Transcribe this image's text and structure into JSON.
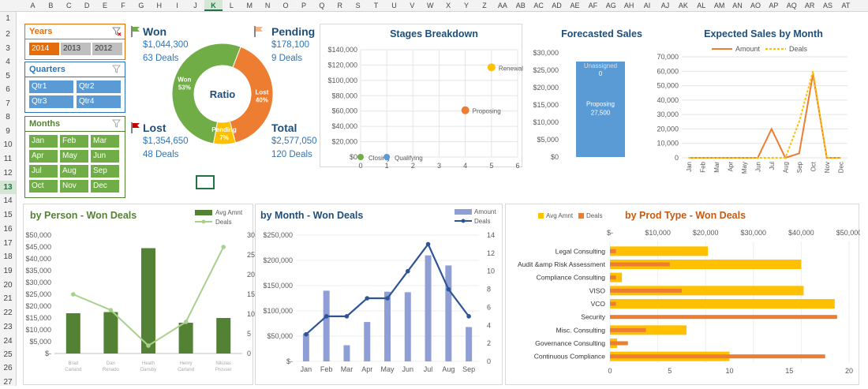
{
  "sheet": {
    "columns": [
      "A",
      "B",
      "C",
      "D",
      "E",
      "F",
      "G",
      "H",
      "I",
      "J",
      "K",
      "L",
      "M",
      "N",
      "O",
      "P",
      "Q",
      "R",
      "S",
      "T",
      "U",
      "V",
      "W",
      "X",
      "Y",
      "Z",
      "AA",
      "AB",
      "AC",
      "AD",
      "AE",
      "AF",
      "AG",
      "AH",
      "AI",
      "AJ",
      "AK",
      "AL",
      "AM",
      "AN",
      "AO",
      "AP",
      "AQ",
      "AR",
      "AS",
      "AT"
    ],
    "selected_column": "K",
    "rows": [
      "1",
      "2",
      "3",
      "4",
      "5",
      "6",
      "7",
      "8",
      "9",
      "10",
      "11",
      "12",
      "13",
      "14",
      "15",
      "16",
      "17",
      "18",
      "19",
      "20",
      "21",
      "22",
      "23",
      "24",
      "25",
      "26",
      "27"
    ],
    "selected_row": "13"
  },
  "slicers": {
    "years": {
      "title": "Years",
      "items": [
        "2014",
        "2013",
        "2012"
      ],
      "selected": "2014"
    },
    "quarters": {
      "title": "Quarters",
      "items": [
        "Qtr1",
        "Qtr2",
        "Qtr3",
        "Qtr4"
      ]
    },
    "months": {
      "title": "Months",
      "items": [
        "Jan",
        "Feb",
        "Mar",
        "Apr",
        "May",
        "Jun",
        "Jul",
        "Aug",
        "Sep",
        "Oct",
        "Nov",
        "Dec"
      ]
    }
  },
  "kpis": {
    "won": {
      "title": "Won",
      "amount": "$1,044,300",
      "deals": "63 Deals"
    },
    "pending": {
      "title": "Pending",
      "amount": "$178,100",
      "deals": "9 Deals"
    },
    "lost": {
      "title": "Lost",
      "amount": "$1,354,650",
      "deals": "48 Deals"
    },
    "total": {
      "title": "Total",
      "amount": "$2,577,050",
      "deals": "120 Deals"
    }
  },
  "colors": {
    "won": "#70ad47",
    "lost": "#ed7d31",
    "pending": "#ffc000",
    "blue": "#5b9bd5",
    "darkgreen": "#548235",
    "title_blue": "#1f4e79",
    "periwinkle": "#8f9fd6",
    "navy": "#2f5597"
  },
  "chart_data": [
    {
      "id": "ratio",
      "type": "pie",
      "title": "Ratio",
      "labels": [
        "Won",
        "Lost",
        "Pending"
      ],
      "values": [
        53,
        40,
        7
      ],
      "value_labels": [
        "53%",
        "40%",
        "7%"
      ]
    },
    {
      "id": "stages",
      "type": "scatter",
      "title": "Stages Breakdown",
      "xlim": [
        0,
        6
      ],
      "ylim": [
        0,
        140000
      ],
      "x_ticks": [
        "0",
        "1",
        "2",
        "3",
        "4",
        "5",
        "6"
      ],
      "y_ticks": [
        "$0",
        "$20,000",
        "$40,000",
        "$60,000",
        "$80,000",
        "$100,000",
        "$120,000",
        "$140,000"
      ],
      "points": [
        {
          "name": "Closing",
          "x": 0,
          "y": 0
        },
        {
          "name": "Qualifying",
          "x": 1,
          "y": 0
        },
        {
          "name": "Proposing",
          "x": 4,
          "y": 61000
        },
        {
          "name": "Renewal",
          "x": 5,
          "y": 117000
        }
      ]
    },
    {
      "id": "forecast",
      "type": "bar",
      "title": "Forecasted Sales",
      "ylim": [
        0,
        30000
      ],
      "y_ticks": [
        "$0",
        "$5,000",
        "$10,000",
        "$15,000",
        "$20,000",
        "$25,000",
        "$30,000"
      ],
      "stack": [
        {
          "name": "Proposing",
          "value": 27500,
          "label": "27,500"
        },
        {
          "name": "Unassigned",
          "value": 0,
          "label": "0"
        }
      ]
    },
    {
      "id": "expected",
      "type": "line",
      "title": "Expected Sales by Month",
      "categories": [
        "Jan",
        "Feb",
        "Mar",
        "Apr",
        "May",
        "Jun",
        "Jul",
        "Aug",
        "Sep",
        "Oct",
        "Nov",
        "Dec"
      ],
      "ylim": [
        0,
        70000
      ],
      "y_ticks": [
        "0",
        "10,000",
        "20,000",
        "30,000",
        "40,000",
        "50,000",
        "60,000",
        "70,000"
      ],
      "series": [
        {
          "name": "Amount",
          "values": [
            0,
            0,
            0,
            0,
            0,
            0,
            20000,
            0,
            3000,
            58000,
            0,
            0
          ]
        },
        {
          "name": "Deals",
          "values": [
            0,
            0,
            0,
            0,
            0,
            0,
            0,
            0,
            25000,
            60000,
            0,
            0
          ]
        }
      ]
    },
    {
      "id": "person",
      "type": "bar",
      "title": "by Person - Won Deals",
      "categories": [
        "Brad Carland",
        "Dan Renado",
        "Heath Dansby",
        "Henry Carland",
        "Nikolas Prosser"
      ],
      "ylim": [
        0,
        50000
      ],
      "y2lim": [
        0,
        30
      ],
      "y_ticks": [
        "$-",
        "$5,000",
        "$10,000",
        "$15,000",
        "$20,000",
        "$25,000",
        "$30,000",
        "$35,000",
        "$40,000",
        "$45,000",
        "$50,000"
      ],
      "y2_ticks": [
        "0",
        "5",
        "10",
        "15",
        "20",
        "25",
        "30"
      ],
      "series": [
        {
          "name": "Avg Amnt",
          "values": [
            17000,
            17500,
            44500,
            13000,
            15000
          ]
        },
        {
          "name": "Deals",
          "values": [
            15,
            11,
            2,
            8,
            27
          ]
        }
      ]
    },
    {
      "id": "month",
      "type": "bar",
      "title": "by Month - Won Deals",
      "categories": [
        "Jan",
        "Feb",
        "Mar",
        "Apr",
        "May",
        "Jun",
        "Jul",
        "Aug",
        "Sep"
      ],
      "bar_positions": [
        0,
        0.5,
        1,
        1.5,
        2,
        2.5,
        3,
        3.5,
        4,
        4.5,
        5,
        5.5,
        6,
        6.5,
        7,
        7.5,
        8,
        8.5
      ],
      "ylim": [
        0,
        250000
      ],
      "y2lim": [
        0,
        14
      ],
      "y_ticks": [
        "$-",
        "$50,000",
        "$100,000",
        "$150,000",
        "$200,000",
        "$250,000"
      ],
      "y2_ticks": [
        "0",
        "2",
        "4",
        "6",
        "8",
        "10",
        "12",
        "14"
      ],
      "series": [
        {
          "name": "Amount",
          "values": [
            55000,
            140000,
            32000,
            78000,
            138000,
            137000,
            210000,
            190000,
            68000
          ]
        },
        {
          "name": "Deals",
          "values": [
            3,
            5,
            5,
            7,
            7,
            10,
            13,
            8,
            5
          ]
        }
      ]
    },
    {
      "id": "prodtype",
      "type": "bar",
      "title": "by Prod Type - Won Deals",
      "categories": [
        "Legal Consulting",
        "Audit &amp Risk Assessment",
        "Compliance Consulting",
        "VISO",
        "VCO",
        "Security",
        "Misc. Consulting",
        "Governance Consulting",
        "Continuous Compliance"
      ],
      "xlim": [
        0,
        50000
      ],
      "x2lim": [
        0,
        20
      ],
      "x_ticks": [
        "$-",
        "$10,000",
        "$20,000",
        "$30,000",
        "$40,000",
        "$50,000"
      ],
      "x2_ticks": [
        "0",
        "5",
        "10",
        "15",
        "20"
      ],
      "series": [
        {
          "name": "Avg Amnt",
          "values": [
            20500,
            40000,
            2500,
            40500,
            47000,
            0,
            16000,
            1500,
            25000
          ]
        },
        {
          "name": "Deals",
          "values": [
            0.5,
            5,
            0.5,
            6,
            0.5,
            19,
            3,
            1.5,
            18
          ]
        }
      ]
    }
  ]
}
